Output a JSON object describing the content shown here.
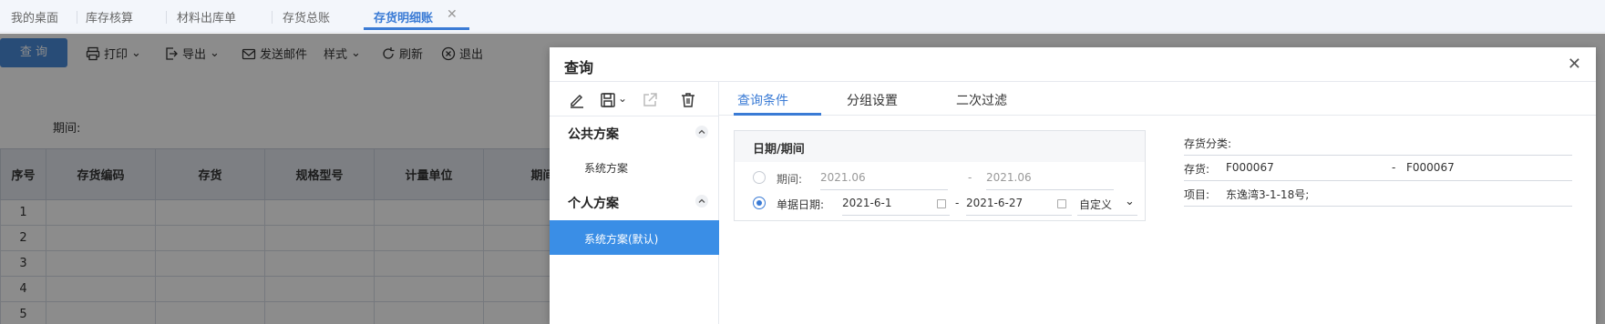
{
  "tabs": [
    {
      "label": "我的桌面"
    },
    {
      "label": "库存核算"
    },
    {
      "label": "材料出库单"
    },
    {
      "label": "存货总账"
    },
    {
      "label": "存货明细账"
    }
  ],
  "toolbar": {
    "query": "查 询",
    "print": "打印",
    "export": "导出",
    "send_mail": "发送邮件",
    "style": "样式",
    "refresh": "刷新",
    "exit": "退出"
  },
  "page": {
    "period_label": "期间:"
  },
  "grid": {
    "columns": [
      "序号",
      "存货编码",
      "存货",
      "规格型号",
      "计量单位",
      "期间"
    ],
    "rows": [
      "1",
      "2",
      "3",
      "4",
      "5"
    ]
  },
  "dialog": {
    "title": "查询",
    "left": {
      "public_section": "公共方案",
      "public_items": [
        "系统方案"
      ],
      "personal_section": "个人方案",
      "personal_items": [
        "系统方案(默认)"
      ]
    },
    "tabs": [
      "查询条件",
      "分组设置",
      "二次过滤"
    ],
    "date_box": {
      "title": "日期/期间",
      "period_label": "期间:",
      "period_from": "2021.06",
      "period_to": "2021.06",
      "doc_date_label": "单据日期:",
      "doc_date_from": "2021-6-1",
      "doc_date_to": "2021-6-27",
      "range_mode": "自定义",
      "dash": "-"
    },
    "filters": {
      "category_label": "存货分类:",
      "inventory_label": "存货:",
      "inventory_from": "F000067",
      "inventory_to": "F000067",
      "project_label": "项目:",
      "project_value": "东逸湾3-1-18号;",
      "dash": "-"
    }
  }
}
